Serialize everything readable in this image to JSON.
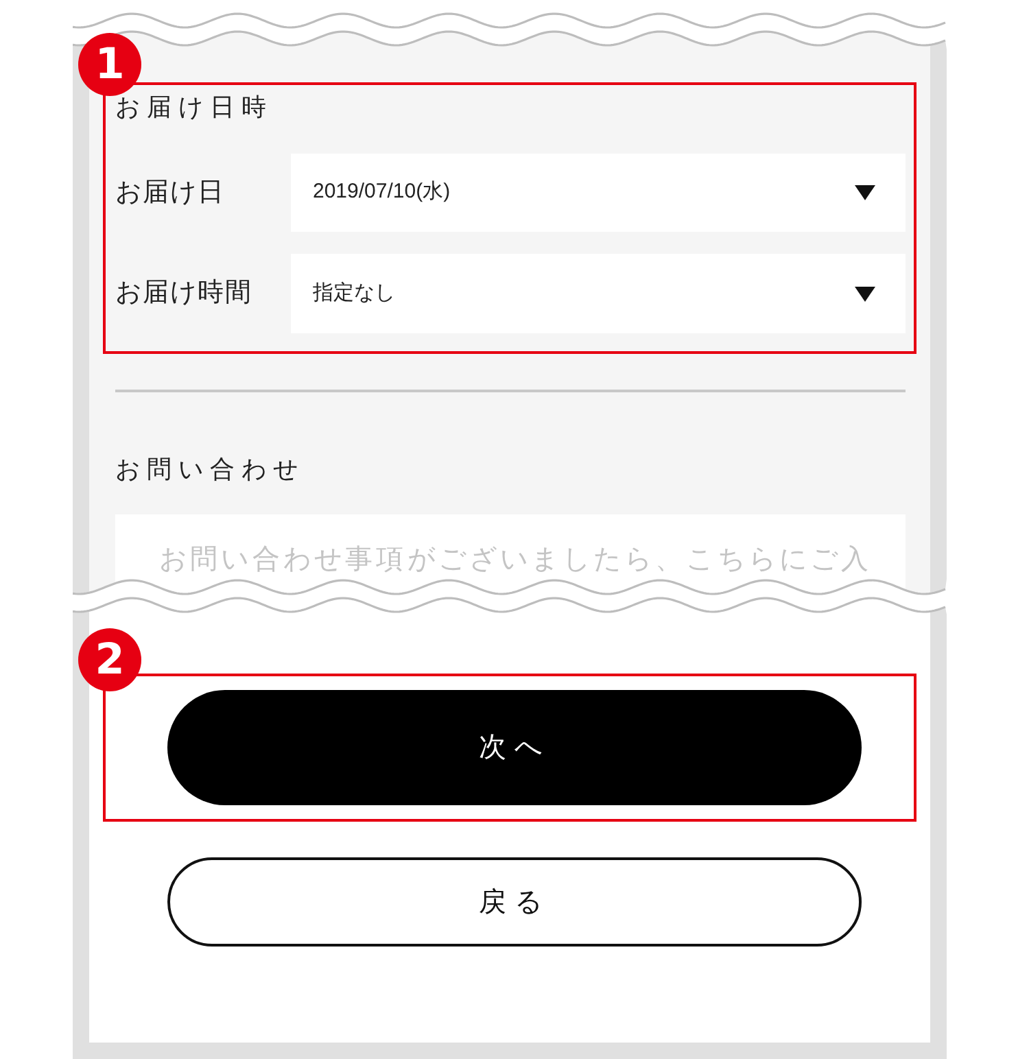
{
  "delivery": {
    "marker": "1",
    "title": "お届け日時",
    "fields": [
      {
        "label": "お届け日",
        "value": "2019/07/10(水)"
      },
      {
        "label": "お届け時間",
        "value": "指定なし"
      }
    ]
  },
  "inquiry": {
    "title": "お問い合わせ",
    "placeholder": "お問い合わせ事項がございましたら、こちらにご入"
  },
  "buttons": [
    {
      "label": "次へ",
      "kind": "primary",
      "marker": "2"
    },
    {
      "label": "戻る",
      "kind": "outline"
    }
  ]
}
